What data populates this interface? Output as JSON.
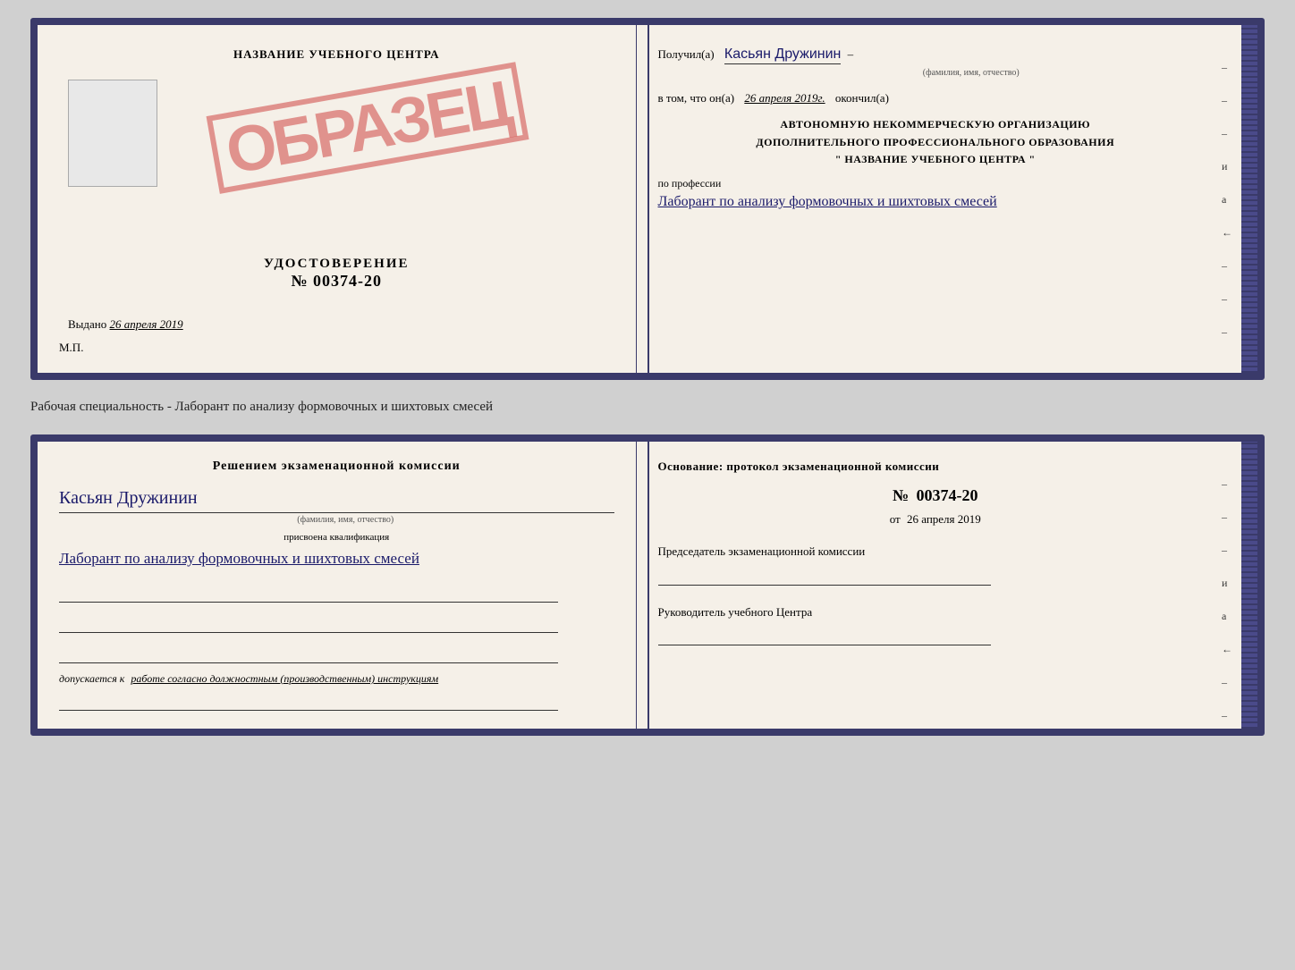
{
  "page": {
    "background": "#d0d0d0"
  },
  "top_card": {
    "left": {
      "title": "НАЗВАНИЕ УЧЕБНОГО ЦЕНТРА",
      "stamp": "ОБРАЗЕЦ",
      "udostoverenie": "УДОСТОВЕРЕНИЕ",
      "number_label": "№",
      "number": "00374-20",
      "issued_label": "Выдано",
      "issued_date": "26 апреля 2019",
      "mp_label": "М.П."
    },
    "right": {
      "poluchil_label": "Получил(а)",
      "poluchil_name": "Касьян Дружинин",
      "fio_subtext": "(фамилия, имя, отчество)",
      "vtomchto_label": "в том, что он(а)",
      "date_value": "26 апреля 2019г.",
      "okonchil_label": "окончил(а)",
      "org_line1": "АВТОНОМНУЮ НЕКОММЕРЧЕСКУЮ ОРГАНИЗАЦИЮ",
      "org_line2": "ДОПОЛНИТЕЛЬНОГО ПРОФЕССИОНАЛЬНОГО ОБРАЗОВАНИЯ",
      "org_line3": "\"   НАЗВАНИЕ УЧЕБНОГО ЦЕНТРА   \"",
      "profession_label": "по профессии",
      "profession_value": "Лаборант по анализу формовочных и шихтовых смесей",
      "right_marks": [
        "–",
        "–",
        "–",
        "и",
        "а",
        "←",
        "–",
        "–",
        "–"
      ]
    }
  },
  "between_label": "Рабочая специальность - Лаборант по анализу формовочных и шихтовых смесей",
  "bottom_card": {
    "left": {
      "decision_title": "Решением  экзаменационной  комиссии",
      "name": "Касьян  Дружинин",
      "fio_subtext": "(фамилия, имя, отчество)",
      "qual_label": "присвоена квалификация",
      "qual_value": "Лаборант по анализу формовочных и шихтовых смесей",
      "dopuskaetsya_prefix": "допускается к",
      "dopuskaetsya_text": "работе согласно должностным (производственным) инструкциям"
    },
    "right": {
      "osnov_title": "Основание: протокол экзаменационной  комиссии",
      "number_label": "№",
      "number": "00374-20",
      "date_prefix": "от",
      "date_value": "26 апреля 2019",
      "predsedatel_label": "Председатель экзаменационной комиссии",
      "rukovoditel_label": "Руководитель учебного Центра",
      "right_marks": [
        "–",
        "–",
        "–",
        "и",
        "а",
        "←",
        "–",
        "–",
        "–"
      ]
    }
  }
}
